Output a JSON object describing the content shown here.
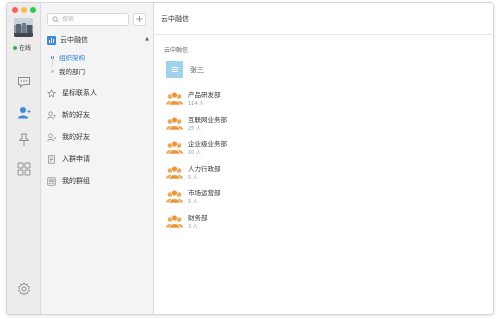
{
  "rail": {
    "status_text": "在线",
    "icons": [
      "chat-icon",
      "contacts-icon",
      "pin-icon",
      "apps-icon",
      "settings-icon"
    ]
  },
  "tree": {
    "search_placeholder": "搜索",
    "add_label": "+",
    "org": {
      "name": "云中融信",
      "items": [
        {
          "label": "组织架构",
          "active": true
        },
        {
          "label": "我的部门",
          "active": false
        }
      ]
    },
    "items": [
      {
        "label": "星标联系人",
        "icon": "star-icon"
      },
      {
        "label": "新的好友",
        "icon": "add-friend-icon"
      },
      {
        "label": "我的好友",
        "icon": "friends-icon"
      },
      {
        "label": "入群申请",
        "icon": "document-icon"
      },
      {
        "label": "我的群组",
        "icon": "group-icon"
      }
    ]
  },
  "content": {
    "title": "云中融信",
    "section_label": "云中融信",
    "person": {
      "name": "张三"
    },
    "departments": [
      {
        "name": "产品研发部",
        "count": "114 人"
      },
      {
        "name": "互联网业务部",
        "count": "25 人"
      },
      {
        "name": "企业级业务部",
        "count": "10 人"
      },
      {
        "name": "人力行政部",
        "count": "5 人"
      },
      {
        "name": "市场运营部",
        "count": "5 人"
      },
      {
        "name": "财务部",
        "count": "3 人"
      }
    ]
  },
  "colors": {
    "accent": "#2f84d4",
    "dept_icon": "#f0a553",
    "online": "#35b445",
    "rail_active": "#3d8bd8"
  }
}
